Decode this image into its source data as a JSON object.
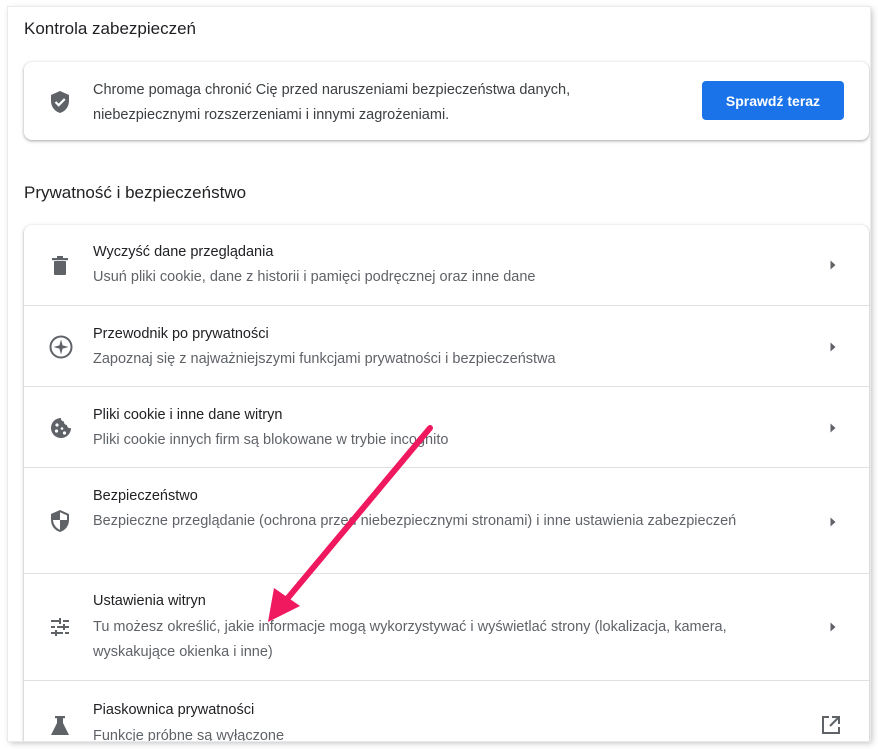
{
  "safety_check": {
    "title": "Kontrola zabezpieczeń",
    "description": "Chrome pomaga chronić Cię przed naruszeniami bezpieczeństwa danych, niebezpiecznymi rozszerzeniami i innymi zagrożeniami.",
    "button_label": "Sprawdź teraz",
    "icon": "shield-check-icon"
  },
  "privacy": {
    "title": "Prywatność i bezpieczeństwo",
    "items": [
      {
        "label": "Wyczyść dane przeglądania",
        "sub": "Usuń pliki cookie, dane z historii i pamięci podręcznej oraz inne dane",
        "icon": "trash-icon",
        "action": "chevron-right-icon"
      },
      {
        "label": "Przewodnik po prywatności",
        "sub": "Zapoznaj się z najważniejszymi funkcjami prywatności i bezpieczeństwa",
        "icon": "compass-icon",
        "action": "chevron-right-icon"
      },
      {
        "label": "Pliki cookie i inne dane witryn",
        "sub": "Pliki cookie innych firm są blokowane w trybie incognito",
        "icon": "cookie-icon",
        "action": "chevron-right-icon"
      },
      {
        "label": "Bezpieczeństwo",
        "sub": "Bezpieczne przeglądanie (ochrona przed niebezpiecznymi stronami) i inne ustawienia zabezpieczeń",
        "icon": "security-shield-icon",
        "action": "chevron-right-icon"
      },
      {
        "label": "Ustawienia witryn",
        "sub": "Tu możesz określić, jakie informacje mogą wykorzystywać i wyświetlać strony (lokalizacja, kamera, wyskakujące okienka i inne)",
        "icon": "tune-sliders-icon",
        "action": "chevron-right-icon"
      },
      {
        "label": "Piaskownica prywatności",
        "sub": "Funkcje próbne są wyłączone",
        "icon": "flask-icon",
        "action": "open-external-icon"
      }
    ]
  },
  "colors": {
    "accent": "#1a73e8",
    "icon": "#5f6368",
    "annotation_arrow": "#f0185e"
  }
}
